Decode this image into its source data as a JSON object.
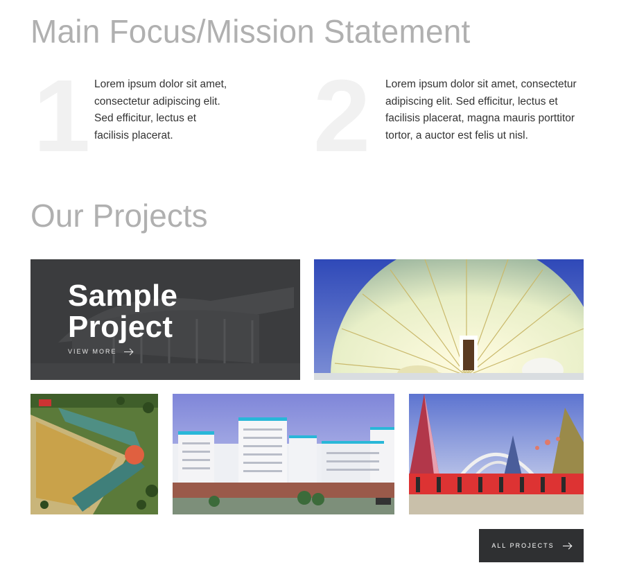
{
  "mission": {
    "title": "Main Focus/Mission Statement",
    "items": [
      {
        "number": "1",
        "text": "Lorem ipsum dolor sit amet, consectetur adipiscing elit. Sed efficitur, lectus et facilisis placerat."
      },
      {
        "number": "2",
        "text": "Lorem ipsum dolor sit amet, consectetur adipiscing elit. Sed efficitur, lectus et facilisis placerat, magna mauris porttitor tortor, a auctor est felis ut nisl."
      }
    ]
  },
  "projects": {
    "title": "Our Projects",
    "featured": {
      "title": "Sample Project",
      "link_label": "VIEW MORE"
    },
    "all_projects_label": "ALL PROJECTS"
  },
  "colors": {
    "heading": "#b0b0b0",
    "number": "#f1f1f1",
    "dark": "#2f3032"
  }
}
